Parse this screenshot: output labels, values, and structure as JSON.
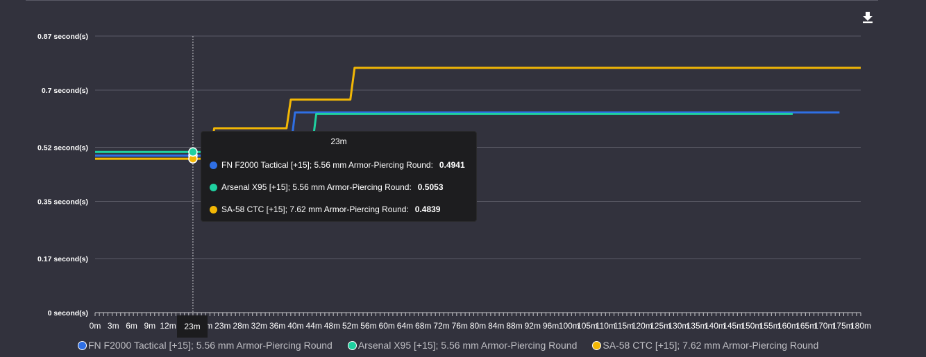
{
  "chart_data": {
    "type": "line",
    "title": "",
    "xlabel": "",
    "ylabel": "",
    "y_unit": " second(s)",
    "ylim": [
      0,
      0.87
    ],
    "yticks": [
      0,
      0.17,
      0.35,
      0.52,
      0.7,
      0.87
    ],
    "ytick_labels": [
      "0 second(s)",
      "0.17 second(s)",
      "0.35 second(s)",
      "0.52 second(s)",
      "0.7 second(s)",
      "0.87 second(s)"
    ],
    "xlim": [
      0,
      180
    ],
    "xtick_labels": [
      "0m",
      "3m",
      "6m",
      "9m",
      "12m",
      "16m",
      "20m",
      "23m",
      "28m",
      "32m",
      "36m",
      "40m",
      "44m",
      "48m",
      "52m",
      "56m",
      "60m",
      "64m",
      "68m",
      "72m",
      "76m",
      "80m",
      "84m",
      "88m",
      "92m",
      "96m",
      "100m",
      "105m",
      "110m",
      "115m",
      "120m",
      "125m",
      "130m",
      "135m",
      "140m",
      "145m",
      "150m",
      "155m",
      "160m",
      "165m",
      "170m",
      "175m",
      "180m"
    ],
    "grid": true,
    "legend_position": "bottom",
    "series": [
      {
        "name": "FN F2000 Tactical [+15]; 5.56 mm Armor-Piercing Round",
        "color": "#2f6fe4",
        "points": [
          [
            0,
            0.4941
          ],
          [
            26,
            0.4941
          ],
          [
            27,
            0.52
          ],
          [
            46,
            0.52
          ],
          [
            47,
            0.63
          ],
          [
            175,
            0.63
          ]
        ]
      },
      {
        "name": "Arsenal X95 [+15]; 5.56 mm Armor-Piercing Round",
        "color": "#1fd1a0",
        "points": [
          [
            0,
            0.5053
          ],
          [
            26,
            0.5053
          ],
          [
            27,
            0.52
          ],
          [
            51,
            0.52
          ],
          [
            52,
            0.625
          ],
          [
            164,
            0.625
          ]
        ]
      },
      {
        "name": "SA-58 CTC [+15]; 7.62 mm Armor-Piercing Round",
        "color": "#f2b705",
        "points": [
          [
            0,
            0.4839
          ],
          [
            27,
            0.4839
          ],
          [
            28,
            0.58
          ],
          [
            45,
            0.58
          ],
          [
            46,
            0.67
          ],
          [
            60,
            0.67
          ],
          [
            61,
            0.77
          ],
          [
            180,
            0.77
          ]
        ]
      }
    ],
    "tooltip": {
      "title": "23m",
      "x": 23,
      "rows": [
        {
          "label": "FN F2000 Tactical [+15]; 5.56 mm Armor-Piercing Round:",
          "value": "0.4941",
          "color": "#2f6fe4"
        },
        {
          "label": "Arsenal X95 [+15]; 5.56 mm Armor-Piercing Round:",
          "value": "0.5053",
          "color": "#1fd1a0"
        },
        {
          "label": "SA-58 CTC [+15]; 7.62 mm Armor-Piercing Round:",
          "value": "0.4839",
          "color": "#f2b705"
        }
      ]
    },
    "crosshair_label": "23m"
  },
  "legend": {
    "items": [
      {
        "label": "FN F2000 Tactical [+15]; 5.56 mm Armor-Piercing Round",
        "color": "#2f6fe4"
      },
      {
        "label": "Arsenal X95 [+15]; 5.56 mm Armor-Piercing Round",
        "color": "#1fd1a0"
      },
      {
        "label": "SA-58 CTC [+15]; 7.62 mm Armor-Piercing Round",
        "color": "#f2b705"
      }
    ]
  },
  "toolbar": {
    "download_icon": "download-icon"
  }
}
